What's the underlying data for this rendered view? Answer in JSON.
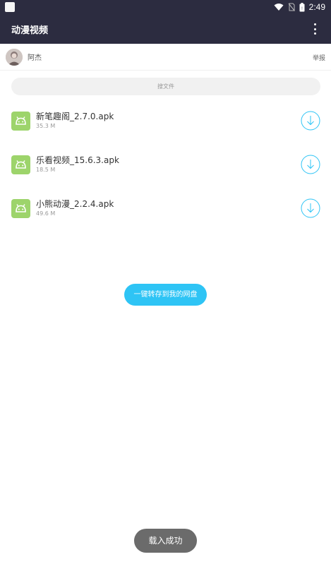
{
  "status_bar": {
    "time": "2:49",
    "icons": [
      "wifi-icon",
      "no-sim-icon",
      "battery-icon"
    ]
  },
  "app_bar": {
    "title": "动漫视频",
    "menu_icon": "more-vert-icon"
  },
  "user": {
    "name": "阿杰",
    "report_label": "举报"
  },
  "search": {
    "placeholder": "搜文件"
  },
  "files": [
    {
      "name": "新笔趣阁_2.7.0.apk",
      "size": "35.3 M",
      "icon": "android-icon"
    },
    {
      "name": "乐看视频_15.6.3.apk",
      "size": "18.5 M",
      "icon": "android-icon"
    },
    {
      "name": "小熊动漫_2.2.4.apk",
      "size": "49.6 M",
      "icon": "android-icon"
    }
  ],
  "save_button_label": "一键转存到我的网盘",
  "toast_message": "载入成功",
  "colors": {
    "app_bar_bg": "#2c2c40",
    "accent": "#2ec4f5",
    "apk_icon_bg": "#9dd46b",
    "toast_bg": "#6b6b6b"
  }
}
